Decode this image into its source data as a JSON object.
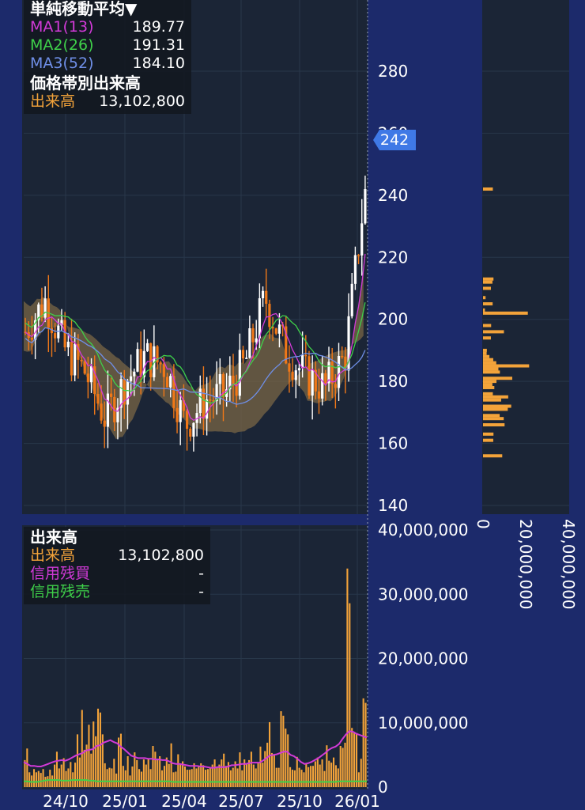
{
  "ma_panel": {
    "title": "単純移動平均▼",
    "items": [
      {
        "label": "MA1(13)",
        "value": "189.77",
        "color": "#d23ad8"
      },
      {
        "label": "MA2(26)",
        "value": "191.31",
        "color": "#3fd14a"
      },
      {
        "label": "MA3(52)",
        "value": "184.10",
        "color": "#6f8fe8"
      }
    ]
  },
  "vbp_panel": {
    "title": "価格帯別出来高",
    "label": "出来高",
    "value": "13,102,800",
    "label_color": "#f3a33a"
  },
  "volume_panel": {
    "title": "出来高",
    "rows": [
      {
        "label": "出来高",
        "value": "13,102,800",
        "color": "#f3a33a"
      },
      {
        "label": "信用残買",
        "value": "-",
        "color": "#d23ad8"
      },
      {
        "label": "信用残売",
        "value": "-",
        "color": "#3fd14a"
      }
    ]
  },
  "current_price_tag": "242",
  "colors": {
    "up_candle": "#ffffff",
    "down_candle": "#f07818",
    "cloud": "#7a6545",
    "volume_bar": "#f3a33a",
    "background": "#1b2536",
    "frame": "#1c2a6b"
  },
  "chart_data": [
    {
      "type": "candlestick",
      "title": "単純移動平均",
      "x_tick_labels": [
        "24/10",
        "25/01",
        "25/04",
        "25/07",
        "25/10",
        "26/01"
      ],
      "y_tick_labels": [
        "140",
        "160",
        "180",
        "200",
        "220",
        "240",
        "260",
        "280"
      ],
      "ylim": [
        140,
        280
      ],
      "close_path": [
        [
          "24/08",
          196
        ],
        [
          "24/09",
          206
        ],
        [
          "24/10",
          190
        ],
        [
          "24/11",
          183
        ],
        [
          "24/12",
          168
        ],
        [
          "25/01",
          180
        ],
        [
          "25/02",
          188
        ],
        [
          "25/03",
          185
        ],
        [
          "25/04",
          166
        ],
        [
          "25/05",
          174
        ],
        [
          "25/06",
          176
        ],
        [
          "25/07",
          186
        ],
        [
          "25/08",
          207
        ],
        [
          "25/09",
          190
        ],
        [
          "25/10",
          182
        ],
        [
          "25/11",
          178
        ],
        [
          "25/12",
          188
        ],
        [
          "26/01",
          242
        ]
      ],
      "series": [
        {
          "name": "MA1(13)",
          "last": 189.77
        },
        {
          "name": "MA2(26)",
          "last": 191.31
        },
        {
          "name": "MA3(52)",
          "last": 184.1
        }
      ]
    },
    {
      "type": "bar",
      "title": "価格帯別出来高",
      "x_tick_labels": [
        "0",
        "20,000,000",
        "40,000,000"
      ],
      "xlim": [
        0,
        40000000
      ],
      "bins": [
        {
          "price": 242,
          "volume": 4600000
        },
        {
          "price": 213,
          "volume": 4900000
        },
        {
          "price": 212,
          "volume": 4400000
        },
        {
          "price": 210,
          "volume": 3700000
        },
        {
          "price": 207,
          "volume": 1200000
        },
        {
          "price": 205,
          "volume": 4500000
        },
        {
          "price": 203,
          "volume": 900000
        },
        {
          "price": 202,
          "volume": 21000000
        },
        {
          "price": 198,
          "volume": 3800000
        },
        {
          "price": 196,
          "volume": 9800000
        },
        {
          "price": 194,
          "volume": 3700000
        },
        {
          "price": 190,
          "volume": 1800000
        },
        {
          "price": 189,
          "volume": 1700000
        },
        {
          "price": 188,
          "volume": 3000000
        },
        {
          "price": 187,
          "volume": 4800000
        },
        {
          "price": 186,
          "volume": 6200000
        },
        {
          "price": 185,
          "volume": 21600000
        },
        {
          "price": 184,
          "volume": 7200000
        },
        {
          "price": 183,
          "volume": 7900000
        },
        {
          "price": 181,
          "volume": 13700000
        },
        {
          "price": 180,
          "volume": 6300000
        },
        {
          "price": 179,
          "volume": 4400000
        },
        {
          "price": 178,
          "volume": 5300000
        },
        {
          "price": 176,
          "volume": 4600000
        },
        {
          "price": 175,
          "volume": 11800000
        },
        {
          "price": 174,
          "volume": 8500000
        },
        {
          "price": 172,
          "volume": 13200000
        },
        {
          "price": 171,
          "volume": 11600000
        },
        {
          "price": 169,
          "volume": 7800000
        },
        {
          "price": 168,
          "volume": 9700000
        },
        {
          "price": 166,
          "volume": 10100000
        },
        {
          "price": 163,
          "volume": 4900000
        },
        {
          "price": 161,
          "volume": 4800000
        },
        {
          "price": 156,
          "volume": 9000000
        }
      ]
    },
    {
      "type": "bar",
      "title": "出来高",
      "x_tick_labels": [
        "24/10",
        "25/01",
        "25/04",
        "25/07",
        "25/10",
        "26/01"
      ],
      "y_tick_labels": [
        "0",
        "10,000,000",
        "20,000,000",
        "30,000,000",
        "40,000,000"
      ],
      "ylim": [
        0,
        40000000
      ],
      "values": [
        4200000,
        6000000,
        2300000,
        1800000,
        2800000,
        2300000,
        2500000,
        2200000,
        2800000,
        1600000,
        1700000,
        2700000,
        1800000,
        3500000,
        5500000,
        2900000,
        3500000,
        4500000,
        2500000,
        2900000,
        3900000,
        2300000,
        3800000,
        8200000,
        4600000,
        12000000,
        5800000,
        6600000,
        9700000,
        5200000,
        10200000,
        7900000,
        12200000,
        11600000,
        8200000,
        3700000,
        2800000,
        3000000,
        2900000,
        4400000,
        2100000,
        7700000,
        8300000,
        3300000,
        2600000,
        4800000,
        1800000,
        3200000,
        5400000,
        4200000,
        2800000,
        2400000,
        4300000,
        3500000,
        4400000,
        2800000,
        6400000,
        5500000,
        4400000,
        4800000,
        2600000,
        3300000,
        4600000,
        3600000,
        6800000,
        2300000,
        2400000,
        5100000,
        3600000,
        4000000,
        3200000,
        2700000,
        2700000,
        2800000,
        3700000,
        2900000,
        3300000,
        3700000,
        3400000,
        2700000,
        2800000,
        3000000,
        3500000,
        4300000,
        3100000,
        3500000,
        4300000,
        5200000,
        3300000,
        3900000,
        2600000,
        3000000,
        4000000,
        2900000,
        5400000,
        2600000,
        4300000,
        3700000,
        4200000,
        5500000,
        3500000,
        2900000,
        3800000,
        6300000,
        3800000,
        5600000,
        6900000,
        10100000,
        5300000,
        5000000,
        3000000,
        3000000,
        11800000,
        11100000,
        9100000,
        8200000,
        3100000,
        2700000,
        2600000,
        4700000,
        3000000,
        2700000,
        2300000,
        3700000,
        3100000,
        3300000,
        3300000,
        4000000,
        4600000,
        3500000,
        4300000,
        2500000,
        6500000,
        4100000,
        3800000,
        4600000,
        3400000,
        2900000,
        6400000,
        6100000,
        6900000,
        34000000,
        28600000,
        9200000,
        8600000,
        8300000,
        2300000,
        4400000,
        13800000,
        13100000
      ],
      "series": [
        {
          "name": "信用残買",
          "values": [
            3900000,
            3600000,
            3300000,
            3300000,
            3200000,
            3200000,
            3400000,
            3600000,
            3800000,
            4000000,
            4100000,
            4200000,
            4100000,
            4300000,
            4600000,
            4900000,
            5100000,
            5300000,
            5700000,
            5800000,
            5900000,
            6400000,
            6500000,
            6900000,
            7100000,
            7300000,
            7000000,
            6800000,
            6300000,
            5900000,
            5400000,
            4900000,
            4700000,
            4500000,
            4500000,
            4500000,
            4400000,
            4400000,
            4300000,
            4300000,
            4200000,
            4200000,
            4000000,
            3700000,
            3600000,
            3600000,
            3500000,
            3400000,
            3300000,
            3300000,
            3300000,
            3200000,
            3200000,
            3100000,
            3000000,
            3000000,
            3100000,
            3100000,
            3100000,
            3200000,
            3400000,
            3400000,
            3500000,
            3600000,
            3600000,
            3700000,
            3800000,
            3800000,
            3800000,
            4100000,
            4500000,
            4900000,
            5000000,
            5100000,
            5300000,
            5500000,
            5500000,
            5000000,
            4800000,
            4400000,
            3900000,
            3600000,
            3700000,
            3900000,
            4200000,
            4500000,
            4900000,
            5300000,
            5800000,
            6100000,
            6300000,
            6700000,
            7500000,
            8200000,
            8700000,
            8600000,
            8300000,
            8100000,
            7900000,
            7700000
          ]
        },
        {
          "name": "信用残売",
          "values": [
            900000,
            900000,
            800000,
            800000,
            800000,
            900000,
            1000000,
            1100000,
            1100000,
            1100000,
            1100000,
            1000000,
            1000000,
            1000000,
            1100000,
            1100000,
            1100000,
            1100000,
            1100000,
            1000000,
            1000000,
            900000,
            900000,
            900000,
            900000,
            900000,
            900000,
            900000,
            900000,
            900000,
            900000,
            900000,
            900000,
            900000,
            900000,
            900000,
            900000,
            900000,
            900000,
            900000,
            900000,
            900000,
            900000,
            800000,
            800000,
            800000,
            800000,
            800000,
            800000,
            800000,
            800000,
            800000,
            800000,
            800000,
            800000,
            800000,
            800000,
            800000,
            800000,
            800000,
            800000,
            800000,
            800000,
            800000,
            800000,
            800000,
            800000,
            800000,
            800000,
            800000,
            800000,
            800000,
            800000,
            800000,
            800000,
            800000,
            800000,
            800000,
            800000,
            800000,
            800000,
            800000,
            800000,
            800000,
            800000,
            800000,
            800000,
            800000,
            800000,
            800000,
            800000,
            900000,
            900000,
            900000,
            900000,
            900000,
            900000,
            900000,
            900000,
            900000
          ]
        }
      ]
    }
  ]
}
